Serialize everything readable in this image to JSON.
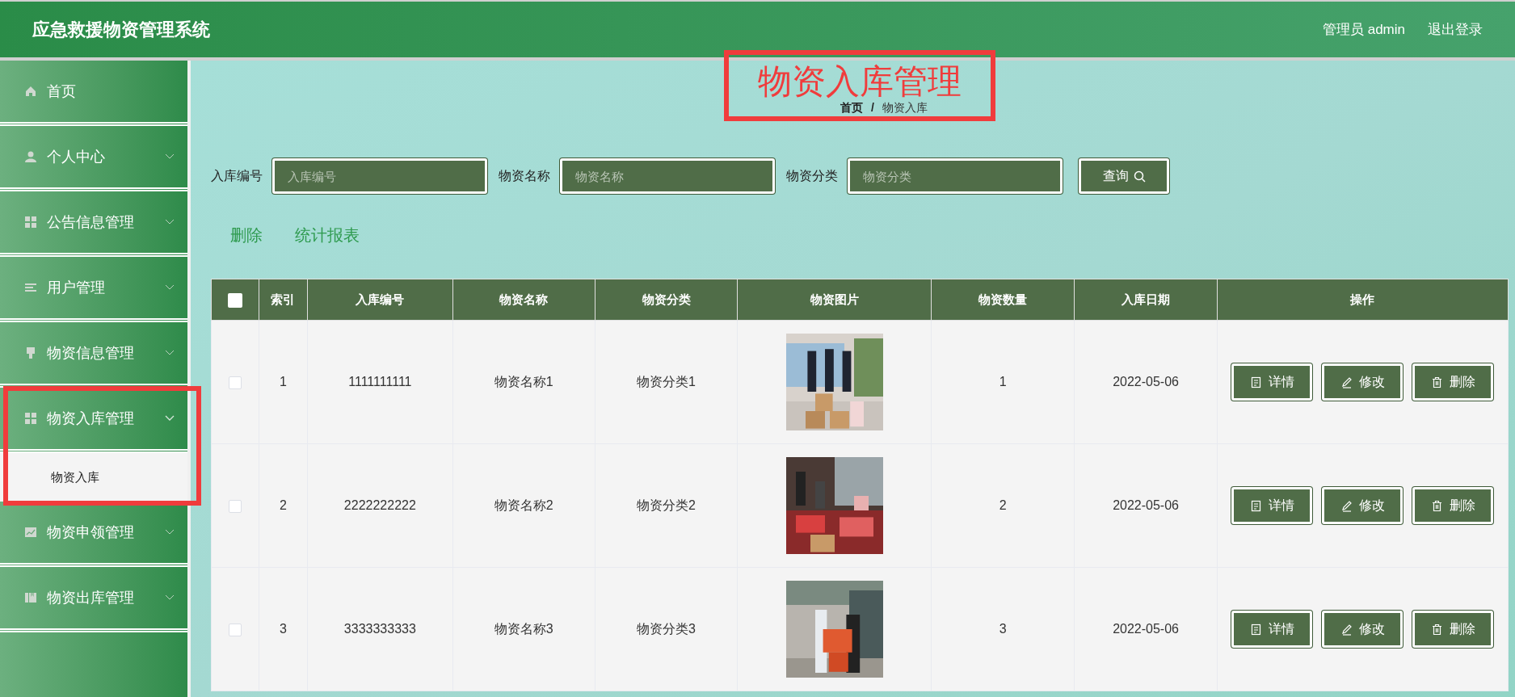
{
  "header": {
    "title": "应急救援物资管理系统",
    "user": "管理员 admin",
    "logout": "退出登录"
  },
  "sidebar": {
    "items": [
      {
        "label": "首页"
      },
      {
        "label": "个人中心",
        "expanded": false
      },
      {
        "label": "公告信息管理",
        "expanded": false
      },
      {
        "label": "用户管理",
        "expanded": false
      },
      {
        "label": "物资信息管理",
        "expanded": false
      },
      {
        "label": "物资入库管理",
        "expanded": true,
        "highlighted": true,
        "children": [
          {
            "label": "物资入库"
          }
        ]
      },
      {
        "label": "物资申领管理",
        "expanded": false
      },
      {
        "label": "物资出库管理",
        "expanded": false
      }
    ]
  },
  "page": {
    "title": "物资入库管理",
    "title_highlighted": true,
    "breadcrumb": [
      "首页",
      "/",
      "物资入库"
    ]
  },
  "search": {
    "fields": [
      {
        "label": "入库编号",
        "placeholder": "入库编号"
      },
      {
        "label": "物资名称",
        "placeholder": "物资名称"
      },
      {
        "label": "物资分类",
        "placeholder": "物资分类"
      }
    ],
    "button": "查询"
  },
  "actions": [
    "删除",
    "统计报表"
  ],
  "table": {
    "header_checked": false,
    "columns": [
      "索引",
      "入库编号",
      "物资名称",
      "物资分类",
      "物资图片",
      "物资数量",
      "入库日期",
      "操作"
    ],
    "rows": [
      {
        "checked": false,
        "index": "1",
        "code": "1111111111",
        "name": "物资名称1",
        "category": "物资分类1",
        "quantity": "1",
        "date": "2022-05-06",
        "buttons": [
          "详情",
          "修改",
          "删除"
        ]
      },
      {
        "checked": false,
        "index": "2",
        "code": "2222222222",
        "name": "物资名称2",
        "category": "物资分类2",
        "quantity": "2",
        "date": "2022-05-06",
        "buttons": [
          "详情",
          "修改",
          "删除"
        ]
      },
      {
        "checked": false,
        "index": "3",
        "code": "3333333333",
        "name": "物资名称3",
        "category": "物资分类3",
        "quantity": "3",
        "date": "2022-05-06",
        "buttons": [
          "详情",
          "修改",
          "删除"
        ]
      }
    ]
  }
}
